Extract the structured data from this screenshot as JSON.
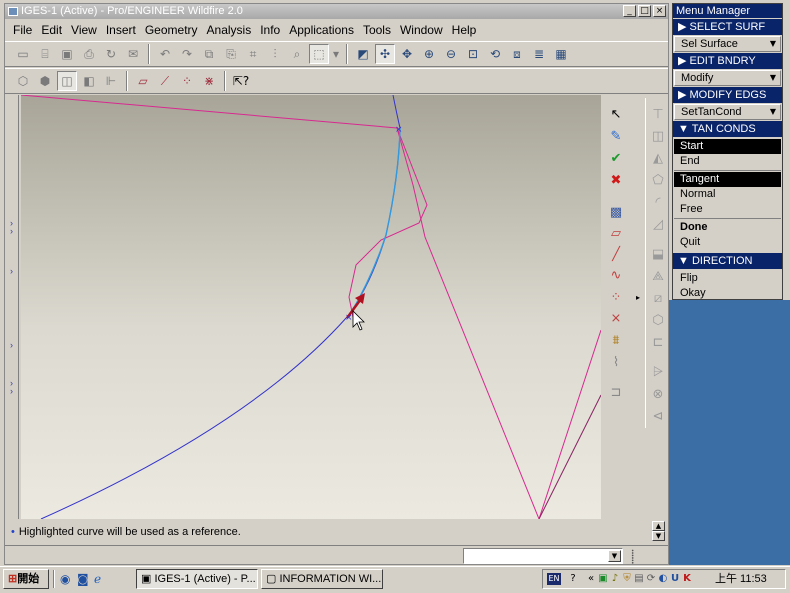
{
  "window": {
    "title": "IGES-1 (Active) - Pro/ENGINEER Wildfire 2.0",
    "min": "_",
    "max": "□",
    "close": "×"
  },
  "menubar": [
    "File",
    "Edit",
    "View",
    "Insert",
    "Geometry",
    "Analysis",
    "Info",
    "Applications",
    "Tools",
    "Window",
    "Help"
  ],
  "message": "Highlighted curve will be used as a reference.",
  "menu_manager": {
    "title": "Menu Manager",
    "select_surf": "SELECT SURF",
    "sel_surface": "Sel Surface",
    "edit_bndry": "EDIT BNDRY",
    "modify": "Modify",
    "modify_edgs": "MODIFY EDGS",
    "settancond": "SetTanCond",
    "tan_conds": "TAN CONDS",
    "tan_items": [
      "Start",
      "End"
    ],
    "cond_items": [
      "Tangent",
      "Normal",
      "Free"
    ],
    "done": "Done",
    "quit": "Quit",
    "direction": "DIRECTION",
    "dir_items": [
      "Flip",
      "Okay"
    ]
  },
  "taskbar": {
    "start": "開始",
    "task1": "IGES-1 (Active) - P...",
    "task2": "INFORMATION WI...",
    "lang": "EN",
    "clock": "上午 11:53"
  },
  "icons": {
    "right_tools": [
      "pointer-icon",
      "edit-curve-icon",
      "accept-check-icon",
      "cancel-x-icon",
      "surface-mesh-icon",
      "plane-icon",
      "line-icon",
      "curve-icon",
      "point-icon",
      "trim-icon",
      "datum-icon",
      "spline-icon",
      "sketch-icon"
    ]
  },
  "colors": {
    "title_active": "#0a246a",
    "curve_magenta": "#d82890",
    "curve_blue": "#3333cc",
    "curve_cyan": "#3399dd",
    "arrow_red": "#b01020",
    "desktop": "#3a6ea5"
  }
}
